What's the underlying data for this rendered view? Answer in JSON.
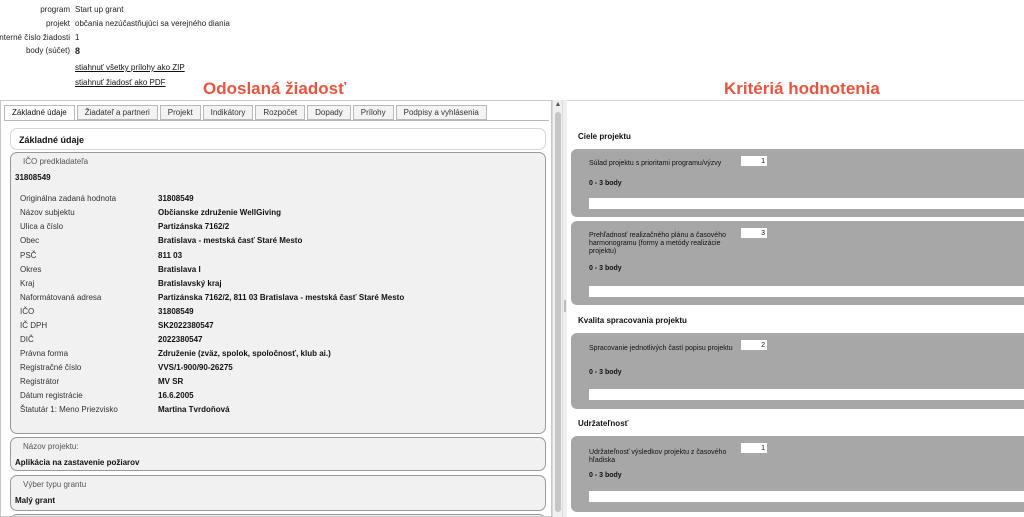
{
  "meta": {
    "program_label": "program",
    "program_value": "Start up grant",
    "projekt_label": "projekt",
    "projekt_value": "občania nezúčastňujúci sa verejného diania",
    "interne_label": "interné číslo žiadosti",
    "interne_value": "1",
    "body_label": "body (súčet)",
    "body_value": "8",
    "zip_link": "stiahnuť všetky prílohy ako ZIP",
    "pdf_link": "stiahnuť žiadosť ako PDF"
  },
  "titles": {
    "left": "Odoslaná žiadosť",
    "right": "Kritériá hodnotenia"
  },
  "tabs": [
    {
      "label": "Základné údaje"
    },
    {
      "label": "Žiadateľ a partneri"
    },
    {
      "label": "Projekt"
    },
    {
      "label": "Indikátory"
    },
    {
      "label": "Rozpočet"
    },
    {
      "label": "Dopady"
    },
    {
      "label": "Prílohy"
    },
    {
      "label": "Podpisy a vyhlásenia"
    }
  ],
  "basic": {
    "header": "Základné údaje",
    "ico_legend": "IČO predkladateľa",
    "ico_value": "31808549",
    "fields": [
      {
        "label": "Originálna zadaná hodnota",
        "value": "31808549"
      },
      {
        "label": "Názov subjektu",
        "value": "Občianske združenie WellGiving"
      },
      {
        "label": "Ulica a číslo",
        "value": "Partizánska 7162/2"
      },
      {
        "label": "Obec",
        "value": "Bratislava - mestská časť Staré Mesto"
      },
      {
        "label": "PSČ",
        "value": "811 03"
      },
      {
        "label": "Okres",
        "value": "Bratislava I"
      },
      {
        "label": "Kraj",
        "value": "Bratislavský kraj"
      },
      {
        "label": "Naformátovaná adresa",
        "value": "Partizánska 7162/2, 811 03 Bratislava - mestská časť Staré Mesto"
      },
      {
        "label": "IČO",
        "value": "31808549"
      },
      {
        "label": "IČ DPH",
        "value": "SK2022380547"
      },
      {
        "label": "DIČ",
        "value": "2022380547"
      },
      {
        "label": "Právna forma",
        "value": "Združenie (zväz, spolok, spoločnosť, klub ai.)"
      },
      {
        "label": "Registračné číslo",
        "value": "VVS/1-900/90-26275"
      },
      {
        "label": "Registrátor",
        "value": "MV SR"
      },
      {
        "label": "Dátum registrácie",
        "value": "16.6.2005"
      },
      {
        "label": "Štatutár 1: Meno Priezvisko",
        "value": "Martina Tvrdoňová"
      }
    ],
    "project_name_legend": "Názov projektu:",
    "project_name_value": "Aplikácia na zastavenie požiarov",
    "grant_type_legend": "Výber typu grantu",
    "grant_type_value": "Malý grant"
  },
  "criteria": {
    "categories": [
      {
        "title": "Ciele projektu"
      },
      {
        "title": "Kvalita spracovania projektu"
      },
      {
        "title": "Udržateľnosť"
      }
    ],
    "items": [
      {
        "text": "Súlad projektu s prioritami programu/výzvy",
        "score": "1",
        "range": "0 - 3 body"
      },
      {
        "text": "Prehľadnosť realizačného plánu a časového harmonogramu (formy a metódy realizácie projektu)",
        "score": "3",
        "range": "0 - 3 body"
      },
      {
        "text": "Spracovanie jednotlivých častí popisu projektu",
        "score": "2",
        "range": "0 - 3 body"
      },
      {
        "text": "Udržateľnosť výsledkov projektu z časového hľadiska",
        "score": "1",
        "range": "0 - 3 body"
      }
    ]
  }
}
